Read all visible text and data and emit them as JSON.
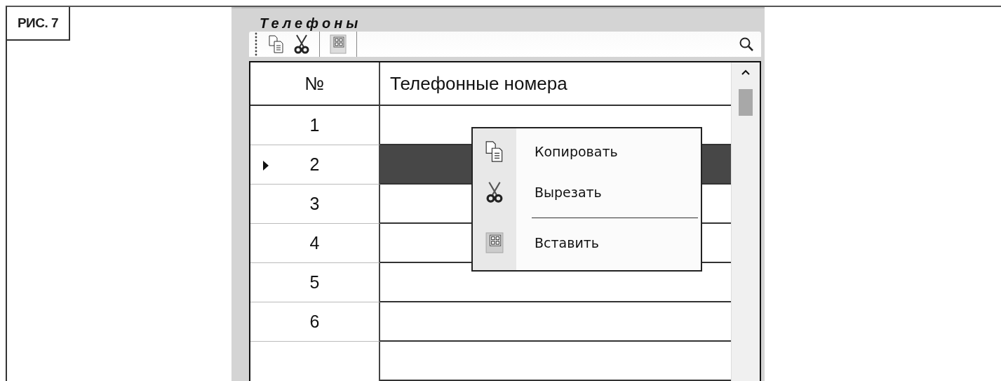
{
  "figure_label": "РИС. 7",
  "panel": {
    "title": "Телефоны"
  },
  "table": {
    "columns": [
      "№",
      "Телефонные номера"
    ],
    "rows": [
      {
        "number": "1",
        "selected": false
      },
      {
        "number": "2",
        "selected": true
      },
      {
        "number": "3",
        "selected": false
      },
      {
        "number": "4",
        "selected": false
      },
      {
        "number": "5",
        "selected": false
      },
      {
        "number": "6",
        "selected": false
      }
    ]
  },
  "context_menu": {
    "items": [
      {
        "kind": "copy",
        "label": "Копировать"
      },
      {
        "kind": "cut",
        "label": "Вырезать"
      },
      {
        "kind": "separator"
      },
      {
        "kind": "paste",
        "label": "Вставить"
      }
    ]
  }
}
